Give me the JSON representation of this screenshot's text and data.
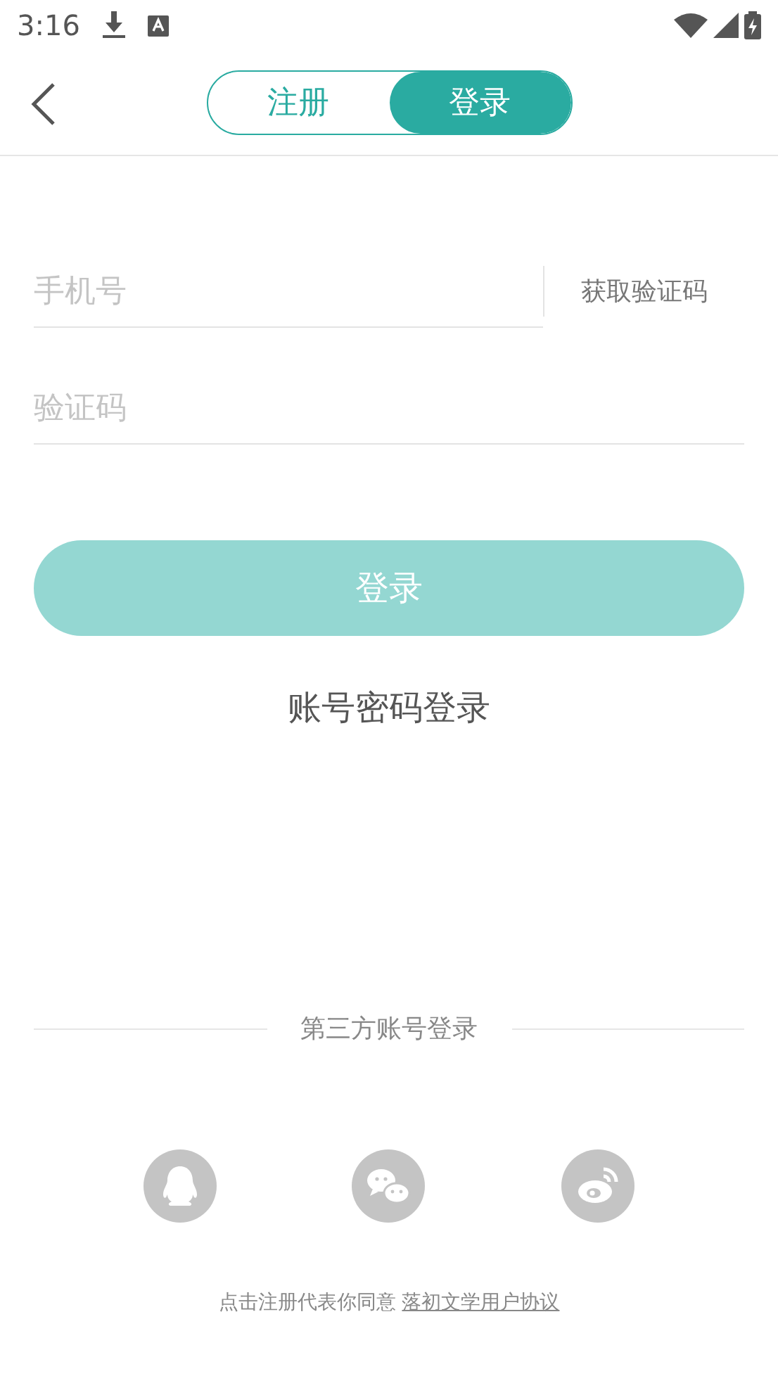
{
  "status_bar": {
    "time": "3:16"
  },
  "tabs": [
    {
      "label": "注册",
      "selected": false
    },
    {
      "label": "登录",
      "selected": true
    }
  ],
  "form": {
    "phone": {
      "placeholder": "手机号"
    },
    "get_code": "获取验证码",
    "code": {
      "placeholder": "验证码"
    },
    "submit": {
      "label": "登录",
      "disabled": true
    },
    "alt_login": "账号密码登录"
  },
  "third_party": {
    "title": "第三方账号登录",
    "providers": [
      {
        "kind": "qq"
      },
      {
        "kind": "wechat"
      },
      {
        "kind": "weibo"
      }
    ]
  },
  "agreement": {
    "text": "点击注册代表你同意",
    "link": "落初文学用户协议"
  }
}
